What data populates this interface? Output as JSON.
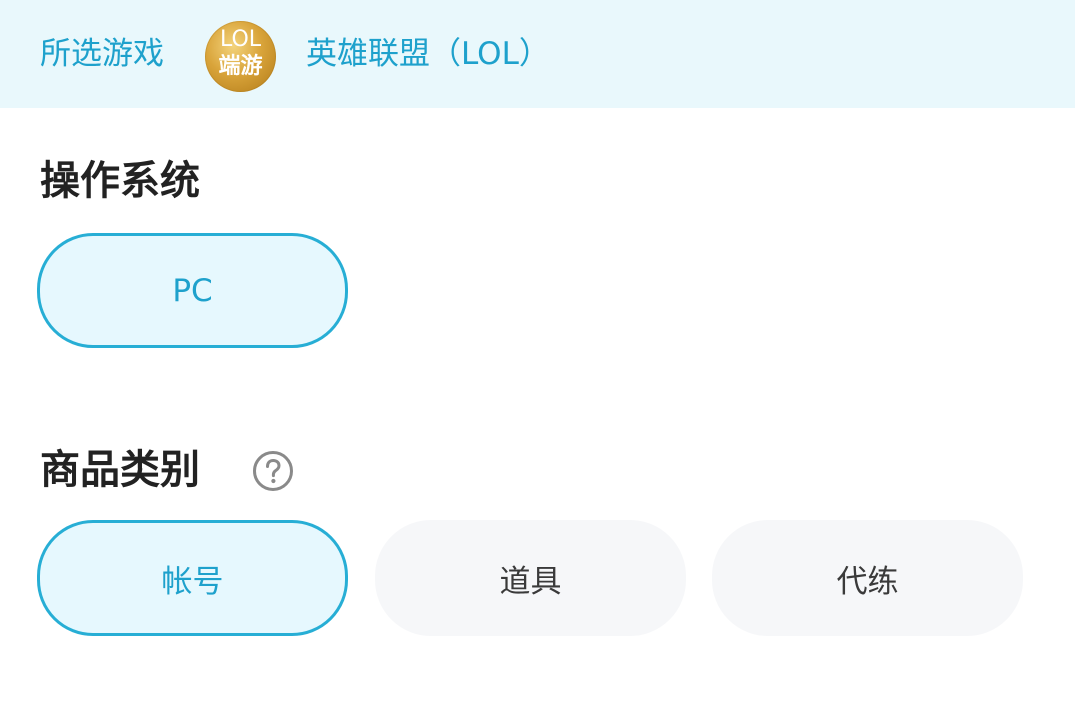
{
  "header": {
    "label": "所选游戏",
    "logo_line1": "LOL",
    "logo_line2": "端游",
    "game_name": "英雄联盟（LOL）"
  },
  "os_section": {
    "title": "操作系统",
    "options": [
      {
        "label": "PC",
        "selected": true
      }
    ]
  },
  "category_section": {
    "title": "商品类别",
    "help_icon": "question-circle-icon",
    "options": [
      {
        "label": "帐号",
        "selected": true
      },
      {
        "label": "道具",
        "selected": false
      },
      {
        "label": "代练",
        "selected": false
      }
    ]
  },
  "colors": {
    "accent": "#1ea1cc",
    "accent_border": "#27aed5",
    "selected_bg": "#e6f8fe",
    "header_bg": "#e9f8fc",
    "unselected_bg": "#f6f7f9",
    "title_text": "#222222"
  }
}
